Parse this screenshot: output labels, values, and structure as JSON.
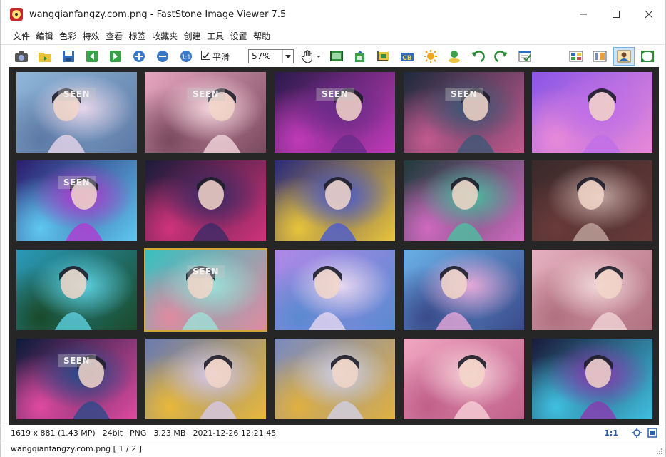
{
  "window": {
    "title": "wangqianfangzy.com.png  -  FastStone Image Viewer 7.5"
  },
  "menu": [
    "文件",
    "编辑",
    "色彩",
    "特效",
    "查看",
    "标签",
    "收藏夹",
    "创建",
    "工具",
    "设置",
    "帮助"
  ],
  "toolbar": {
    "smooth_label": "平滑",
    "smooth_checked": true,
    "zoom_value": "57%"
  },
  "thumbnails": {
    "seen_label": "SEEN",
    "items": [
      {
        "seen": true,
        "colors": [
          "#8fb6d8",
          "#e7d6ea",
          "#5d7aa6"
        ]
      },
      {
        "seen": true,
        "colors": [
          "#e7a6c0",
          "#f3d6dd",
          "#7a4a5e"
        ]
      },
      {
        "seen": true,
        "colors": [
          "#2a1a4a",
          "#6a2c8a",
          "#c03ab8"
        ]
      },
      {
        "seen": true,
        "colors": [
          "#1e2a3e",
          "#3c5876",
          "#c25a8e"
        ]
      },
      {
        "seen": false,
        "colors": [
          "#8a56e6",
          "#c06ee8",
          "#e889d9"
        ]
      },
      {
        "seen": true,
        "colors": [
          "#2b1d6e",
          "#b23ad0",
          "#5ec8f0"
        ]
      },
      {
        "seen": false,
        "colors": [
          "#1b1b3a",
          "#3b2a66",
          "#d0337a"
        ]
      },
      {
        "seen": false,
        "colors": [
          "#2c2a7a",
          "#4a5ad0",
          "#e8c43a"
        ]
      },
      {
        "seen": false,
        "colors": [
          "#1f3a3a",
          "#4ac0a0",
          "#d06ac0"
        ]
      },
      {
        "seen": false,
        "colors": [
          "#3a2a2a",
          "#c2a6a0",
          "#6a3a3a"
        ]
      },
      {
        "seen": false,
        "colors": [
          "#2a9ab8",
          "#5ed0e0",
          "#1a4a2a"
        ]
      },
      {
        "seen": true,
        "colors": [
          "#38c0c0",
          "#9ee0d8",
          "#e08aa0"
        ]
      },
      {
        "seen": false,
        "colors": [
          "#b088e8",
          "#e6d8f0",
          "#5a8ad0"
        ]
      },
      {
        "seen": false,
        "colors": [
          "#6ab0e8",
          "#e6a8d8",
          "#3a4a8a"
        ]
      },
      {
        "seen": false,
        "colors": [
          "#e6b0c0",
          "#f0d6d6",
          "#b07080"
        ]
      },
      {
        "seen": true,
        "colors": [
          "#0c1a3a",
          "#2a4a8a",
          "#e04aa0"
        ]
      },
      {
        "seen": false,
        "colors": [
          "#6a7ab0",
          "#d6c8e8",
          "#e8b83a"
        ]
      },
      {
        "seen": false,
        "colors": [
          "#7a8ac0",
          "#cfd0e6",
          "#e0b040"
        ]
      },
      {
        "seen": false,
        "colors": [
          "#f0a6c0",
          "#f6d0d8",
          "#c0608a"
        ]
      },
      {
        "seen": false,
        "colors": [
          "#1a1a3a",
          "#8a3ab0",
          "#40c0e0"
        ]
      }
    ]
  },
  "status": {
    "dimensions": "1619 x 881 (1.43 MP)",
    "bitdepth": "24bit",
    "format": "PNG",
    "filesize": "3.23 MB",
    "datetime": "2021-12-26 12:21:45",
    "ratio": "1:1",
    "filename": "wangqianfangzy.com.png [ 1 / 2 ]"
  }
}
